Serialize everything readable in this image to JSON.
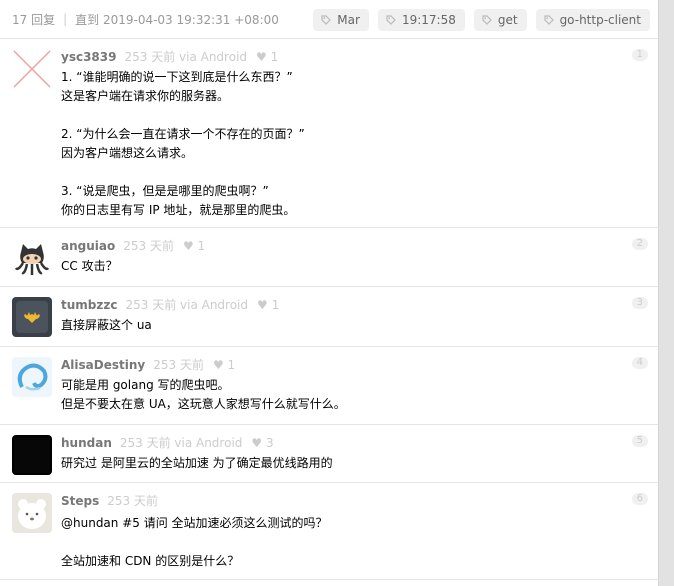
{
  "header": {
    "replies": "17 回复",
    "until": "直到 2019-04-03 19:32:31 +08:00",
    "tags": [
      "Mar",
      "19:17:58",
      "get",
      "go-http-client"
    ]
  },
  "replies": [
    {
      "user": "ysc3839",
      "ago": "253 天前 via Android",
      "hearts": "♥ 1",
      "floor": "1",
      "lines": [
        "1. “谁能明确的说一下这到底是什么东西？”",
        "这是客户端在请求你的服务器。",
        "",
        "2. “为什么会一直在请求一个不存在的页面？”",
        "因为客户端想这么请求。",
        "",
        "3. “说是爬虫，但是是哪里的爬虫啊？”",
        "你的日志里有写 IP 地址，就是那里的爬虫。"
      ]
    },
    {
      "user": "anguiao",
      "ago": "253 天前",
      "hearts": "♥ 1",
      "floor": "2",
      "lines": [
        "CC 攻击？"
      ]
    },
    {
      "user": "tumbzzc",
      "ago": "253 天前 via Android",
      "hearts": "♥ 1",
      "floor": "3",
      "lines": [
        "直接屏蔽这个 ua"
      ]
    },
    {
      "user": "AlisaDestiny",
      "ago": "253 天前",
      "hearts": "♥ 1",
      "floor": "4",
      "lines": [
        "可能是用 golang 写的爬虫吧。",
        "但是不要太在意 UA，这玩意人家想写什么就写什么。"
      ]
    },
    {
      "user": "hundan",
      "ago": "253 天前 via Android",
      "hearts": "♥ 3",
      "floor": "5",
      "lines": [
        "研究过 是阿里云的全站加速 为了确定最优线路用的"
      ]
    },
    {
      "user": "Steps",
      "ago": "253 天前",
      "hearts": "",
      "floor": "6",
      "lines": [
        "@hundan #5 请问 全站加速必须这么测试的吗？",
        "",
        "全站加速和 CDN 的区别是什么？"
      ]
    }
  ],
  "colors": {
    "text": "#000000",
    "muted": "#999999",
    "username": "#777777",
    "tag_bg": "#f0f0f0"
  },
  "icons": [
    "tag-icon",
    "heart-icon",
    "broken-avatar-icon",
    "octocat-avatar-icon",
    "batman-avatar-icon",
    "swirl-avatar-icon",
    "black-avatar-icon",
    "bear-avatar-icon"
  ]
}
